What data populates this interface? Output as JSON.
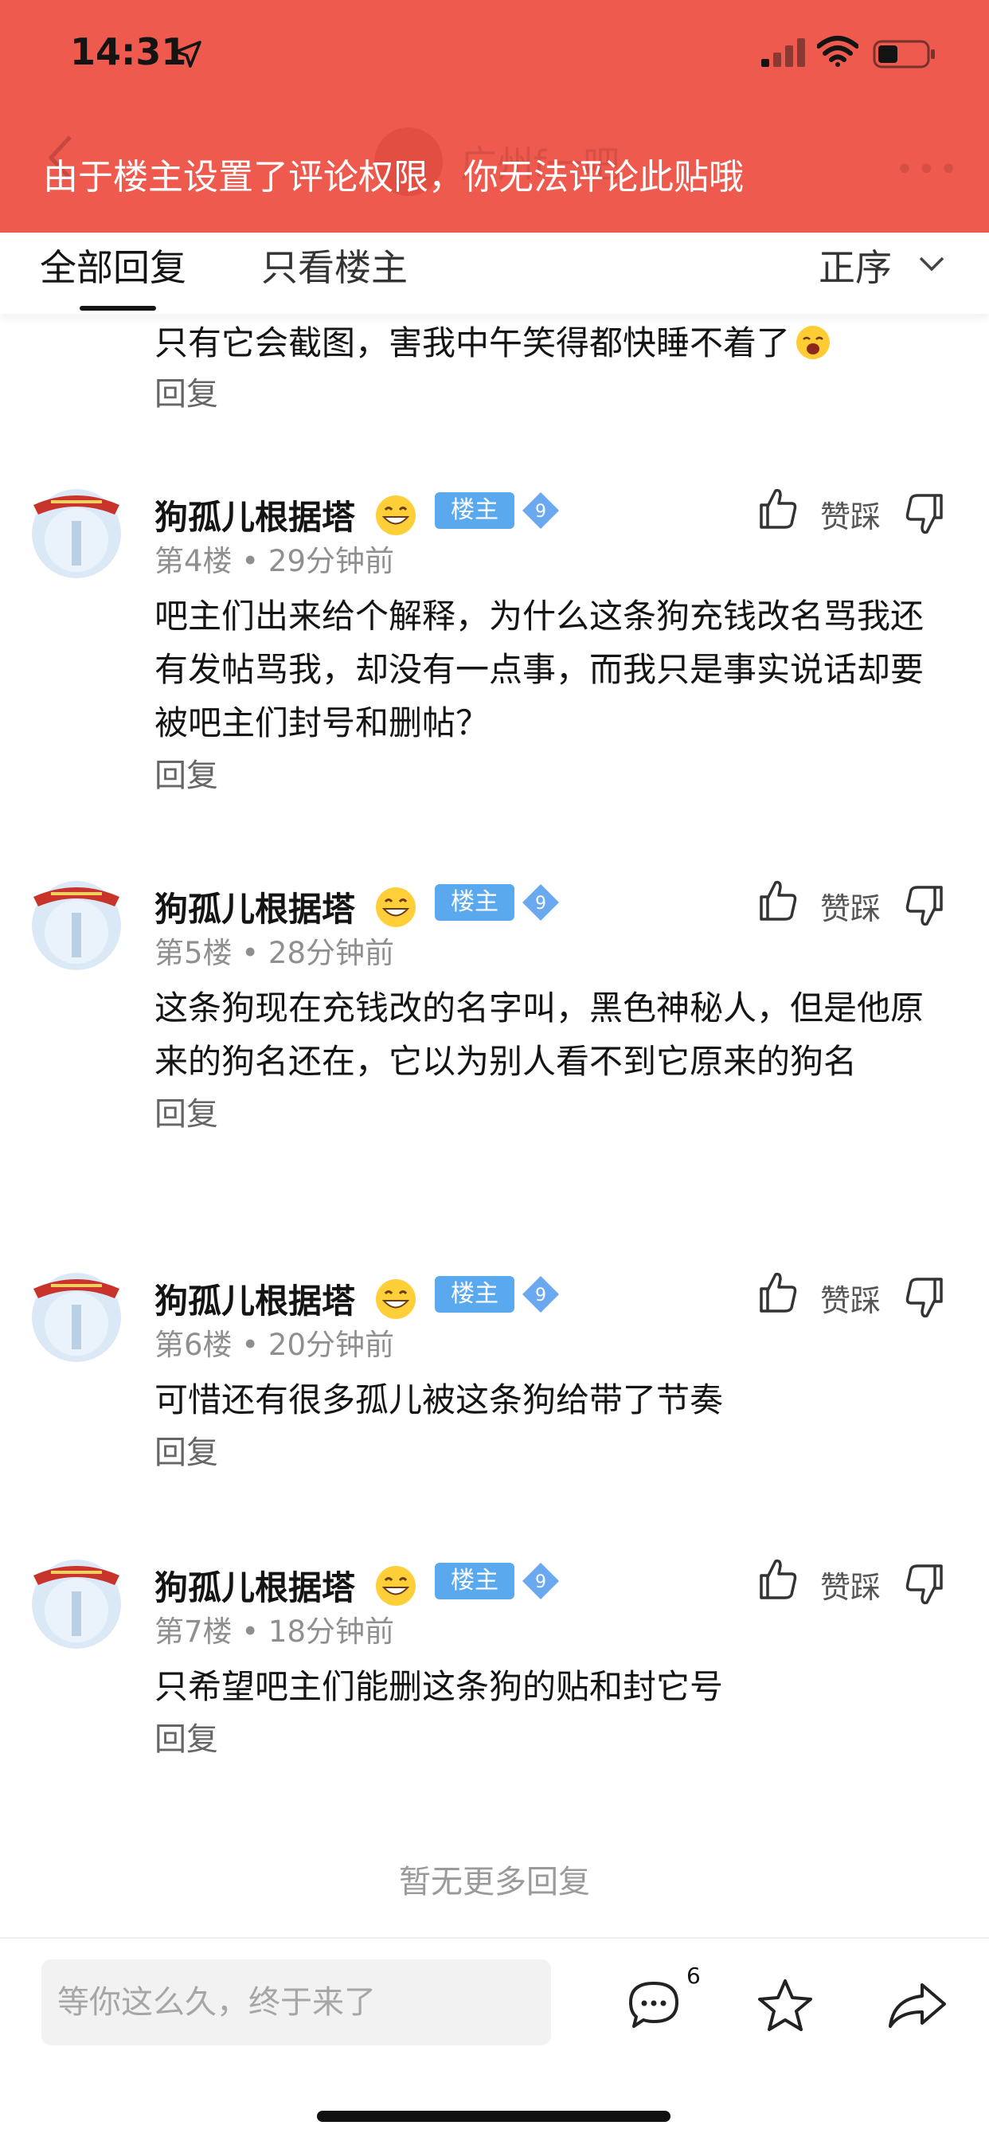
{
  "status_bar": {
    "time": "14:31"
  },
  "header": {
    "forum_title_obscured": "广州f一吧",
    "notice": "由于楼主设置了评论权限，你无法评论此贴哦"
  },
  "tabs": {
    "all_replies": "全部回复",
    "owner_only": "只看楼主",
    "sort": "正序"
  },
  "partial_post": {
    "text": "只有它会截图，害我中午笑得都快睡不着了",
    "reply": "回复"
  },
  "posts": [
    {
      "username": "狗孤儿根据塔",
      "owner_badge": "楼主",
      "level": "9",
      "floor": "第4楼",
      "time": "29分钟前",
      "body": "吧主们出来给个解释，为什么这条狗充钱改名骂我还有发帖骂我，却没有一点事，而我只是事实说话却要被吧主们封号和删帖？",
      "vote_label": "赞踩",
      "reply": "回复"
    },
    {
      "username": "狗孤儿根据塔",
      "owner_badge": "楼主",
      "level": "9",
      "floor": "第5楼",
      "time": "28分钟前",
      "body": "这条狗现在充钱改的名字叫，黑色神秘人，但是他原来的狗名还在，它以为别人看不到它原来的狗名",
      "vote_label": "赞踩",
      "reply": "回复"
    },
    {
      "username": "狗孤儿根据塔",
      "owner_badge": "楼主",
      "level": "9",
      "floor": "第6楼",
      "time": "20分钟前",
      "body": "可惜还有很多孤儿被这条狗给带了节奏",
      "vote_label": "赞踩",
      "reply": "回复"
    },
    {
      "username": "狗孤儿根据塔",
      "owner_badge": "楼主",
      "level": "9",
      "floor": "第7楼",
      "time": "18分钟前",
      "body": "只希望吧主们能删这条狗的贴和封它号",
      "vote_label": "赞踩",
      "reply": "回复"
    }
  ],
  "no_more": "暂无更多回复",
  "bottom": {
    "input_placeholder": "等你这么久，终于来了",
    "comment_count": "6"
  },
  "colors": {
    "banner": "#ee5a4d",
    "owner_badge": "#5aa9ef",
    "level_badge": "#6aa9f0"
  },
  "icons": [
    "location-arrow-icon",
    "signal-icon",
    "wifi-icon",
    "battery-icon",
    "chevron-down-icon",
    "thumb-up-icon",
    "thumb-down-icon",
    "message-icon",
    "star-icon",
    "share-icon",
    "grin-emoji-icon"
  ]
}
